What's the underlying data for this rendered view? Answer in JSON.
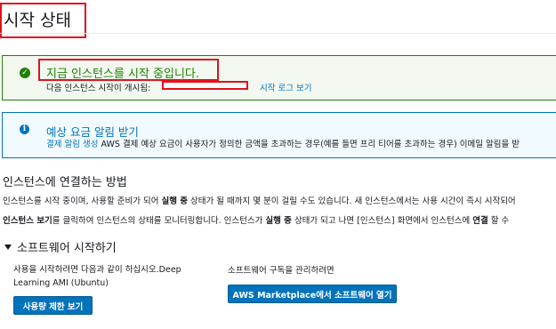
{
  "page": {
    "title": "시작 상태"
  },
  "success": {
    "title": "지금 인스턴스를 시작 중입니다.",
    "sub_label": "다음 인스턴스 시작이 개시됨:",
    "log_link": "시작 로그 보기"
  },
  "info": {
    "title": "예상 요금 알림 받기",
    "link": "결제 알림 생성",
    "text": "AWS 결제 예상 요금이 사용자가 정의한 금액을 초과하는 경우(예를 들면 프리 티어를 초과하는 경우) 이메일 알림을 받"
  },
  "connect": {
    "heading": "인스턴스에 연결하는 방법",
    "p1_a": "인스턴스를 시작 중이며, 사용할 준비가 되어 ",
    "p1_b": "실행 중",
    "p1_c": " 상태가 될 때까지 몇 분이 걸릴 수도 있습니다. 새 인스턴스에서는 사용 시간이 즉시 시작되어",
    "p2_a": "인스턴스 보기",
    "p2_b": "를 클릭하여 인스턴스의 상태를 모니터링합니다. 인스턴스가 ",
    "p2_c": "실행 중",
    "p2_d": " 상태가 되고 나면 [인스턴스] 화면에서 인스턴스에 ",
    "p2_e": "연결",
    "p2_f": " 할 수"
  },
  "software": {
    "heading": "소프트웨어 시작하기",
    "left_text": "사용을 시작하려면 다음과 같이 하십시오.Deep Learning AMI (Ubuntu)",
    "usage_button": "사용량 제한 보기",
    "right_text": "소프트웨어 구독을 관리하려면",
    "marketplace_button": "AWS Marketplace에서 소프트웨어 열기"
  },
  "colors": {
    "success": "#1d8102",
    "info": "#0073bb",
    "annotation_red": "#e0121c"
  }
}
